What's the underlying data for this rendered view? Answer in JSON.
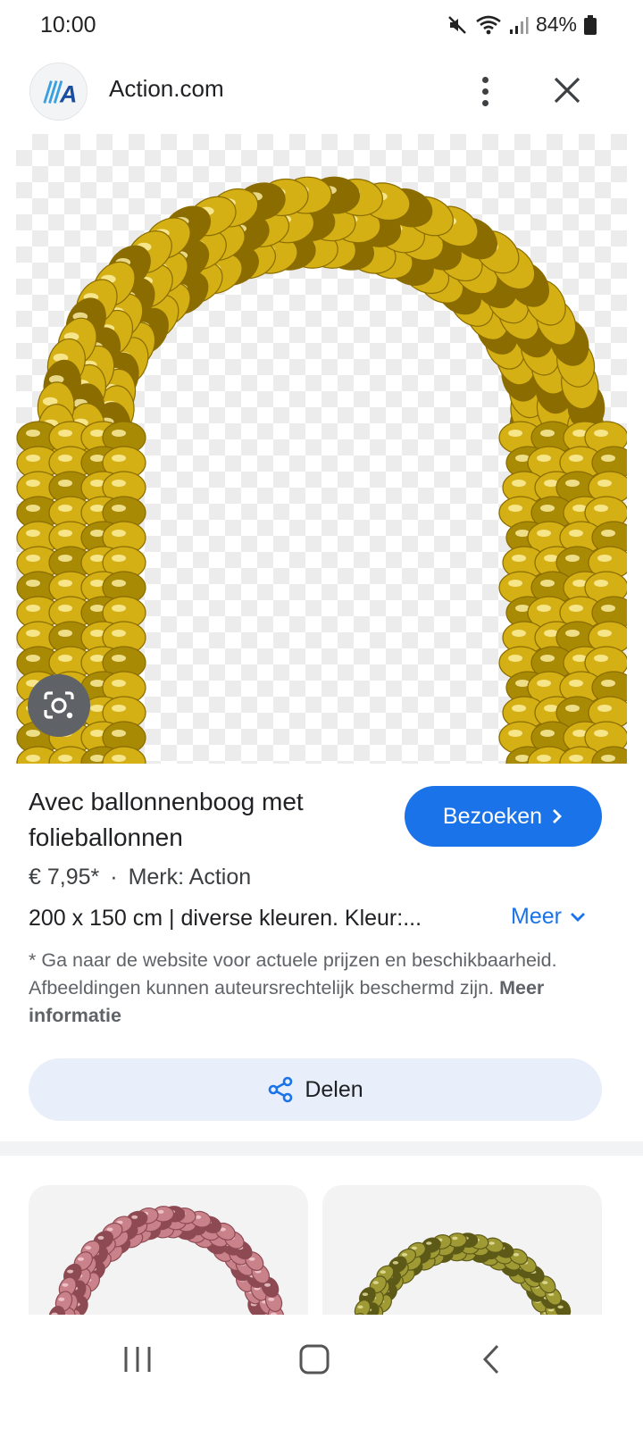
{
  "status_bar": {
    "time": "10:00",
    "battery": "84%",
    "icons": [
      "mute-icon",
      "wifi-icon",
      "signal-icon",
      "battery-icon"
    ]
  },
  "header": {
    "favicon_letter": "A",
    "site_name": "Action.com",
    "icons": [
      "more-vert-icon",
      "close-icon"
    ],
    "brand_color": "#1a4fa0"
  },
  "product": {
    "title": "Avec ballonnenboog met folieballonnen",
    "visit_label": "Bezoeken",
    "price": "€ 7,95*",
    "separator": "·",
    "brand": "Merk: Action",
    "description": "200 x 150 cm | diverse kleuren. Kleur:...",
    "more_label": "Meer",
    "disclaimer": "* Ga naar de website voor actuele prijzen en beschikbaarheid. Afbeeldingen kunnen auteursrechtelijk beschermd zijn.",
    "disclaimer_link": "Meer informatie",
    "share_label": "Delen"
  },
  "colors": {
    "accent": "#1a73e8",
    "share_bg": "#e8effa",
    "gold": "#d4b014",
    "pink": "#c9828a",
    "olive": "#a09a35"
  }
}
